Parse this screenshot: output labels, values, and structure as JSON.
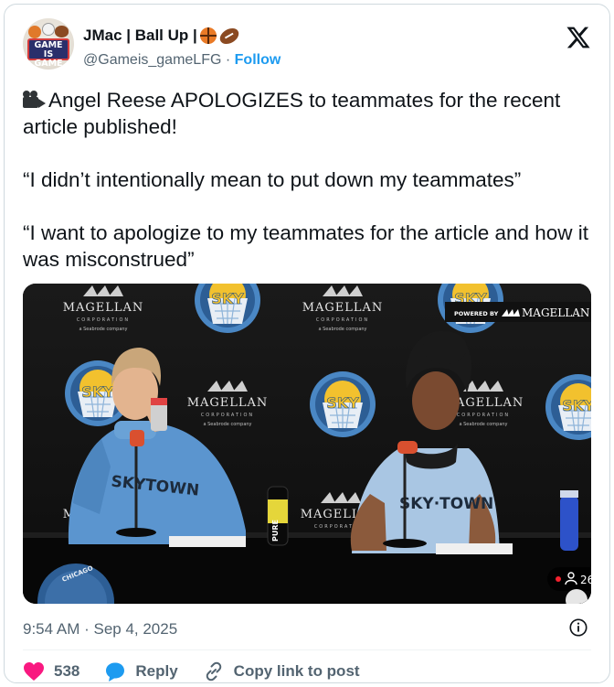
{
  "author": {
    "display_name": "JMac | Ball Up |",
    "handle": "@Gameis_gameLFG",
    "separator": "·",
    "follow_label": "Follow",
    "avatar_text": "GAME IS GAME"
  },
  "tweet": {
    "paragraphs": [
      "Angel Reese APOLOGIZES to teammates for the recent article published!",
      "“I didn’t intentionally mean to put down my teammates”",
      "“I want to apologize to my teammates for the article and how it was misconstrued”"
    ],
    "leading_icon": "video-camera-icon"
  },
  "media": {
    "sponsor_powered_by": "POWERED BY",
    "sponsor_name": "MAGELLAN",
    "banner_brand": "MAGELLAN",
    "banner_sub": "CORPORATION",
    "banner_tag": "a Seabrode company",
    "team_logo_word": "SKY",
    "team_logo_ring": "CHICAGO",
    "jersey_left": "SKYTOWN",
    "jersey_right": "SKY·TOWN",
    "bottle_brand": "PURE",
    "corner_text": "CHICAGO",
    "viewer_count": "26"
  },
  "footer": {
    "timestamp": "9:54 AM · Sep 4, 2025",
    "like_count": "538",
    "reply_label": "Reply",
    "copy_link_label": "Copy link to post"
  },
  "colors": {
    "accent": "#1d9bf0",
    "like": "#f91880",
    "text": "#0f1419",
    "muted": "#536471"
  }
}
